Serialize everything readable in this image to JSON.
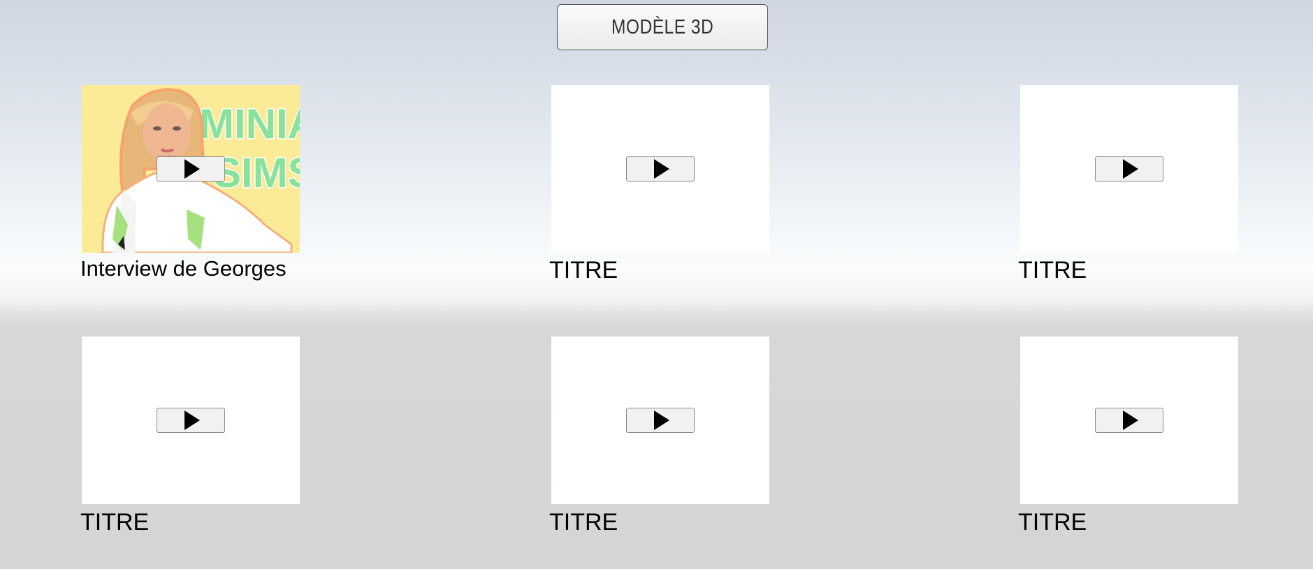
{
  "header": {
    "button_label": "MODÈLE 3D"
  },
  "videos": [
    {
      "title": "Interview de Georges",
      "thumbnail": "sims-character",
      "play_icon": "play-icon"
    },
    {
      "title": "TITRE",
      "thumbnail": "blank",
      "play_icon": "play-icon"
    },
    {
      "title": "TITRE",
      "thumbnail": "blank",
      "play_icon": "play-icon"
    },
    {
      "title": "TITRE",
      "thumbnail": "blank",
      "play_icon": "play-icon"
    },
    {
      "title": "TITRE",
      "thumbnail": "blank",
      "play_icon": "play-icon"
    },
    {
      "title": "TITRE",
      "thumbnail": "blank",
      "play_icon": "play-icon"
    }
  ],
  "thumbnail_texts": {
    "line1": "MINIA",
    "line2": "SIMS"
  },
  "colors": {
    "thumb_bg": "#fbe98c",
    "thumb_text": "#88e29a",
    "card_bg": "#ffffff"
  }
}
